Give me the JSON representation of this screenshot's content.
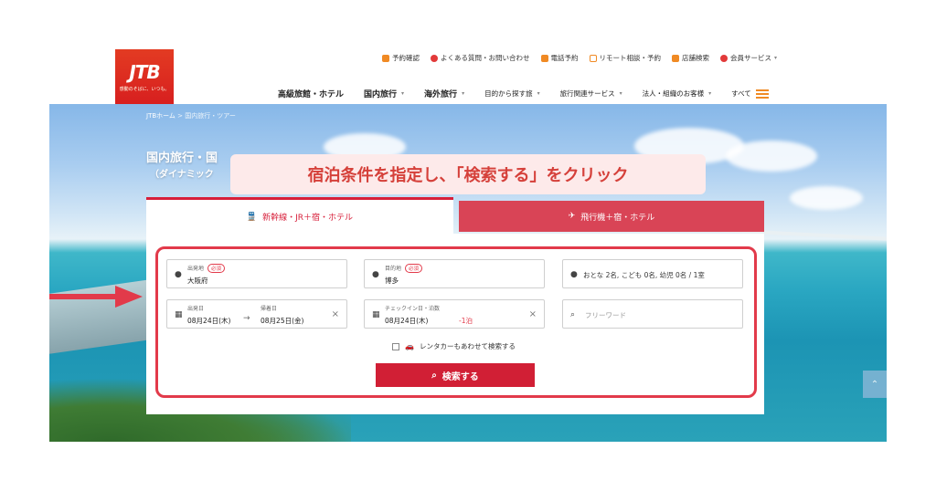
{
  "header": {
    "logo_text": "JTB",
    "logo_tagline": "感動のそばに、いつも。",
    "utility_links": [
      {
        "label": "予約確認",
        "icon": "calendar-icon"
      },
      {
        "label": "よくある質問・お問い合わせ",
        "icon": "help-icon"
      },
      {
        "label": "電話予約",
        "icon": "phone-icon"
      },
      {
        "label": "リモート相談・予約",
        "icon": "monitor-icon"
      },
      {
        "label": "店舗検索",
        "icon": "store-icon"
      },
      {
        "label": "会員サービス",
        "icon": "user-icon"
      }
    ],
    "nav": [
      {
        "label": "高級旅館・ホテル"
      },
      {
        "label": "国内旅行"
      },
      {
        "label": "海外旅行"
      },
      {
        "label": "目的から探す旅"
      },
      {
        "label": "旅行関連サービス"
      },
      {
        "label": "法人・組織のお客様"
      },
      {
        "label": "すべて"
      }
    ]
  },
  "breadcrumb": {
    "home": "JTBホーム",
    "sep": ">",
    "current": "国内旅行・ツアー"
  },
  "hero": {
    "title": "国内旅行・国",
    "subtitle": "（ダイナミック",
    "banner": "宿泊条件を指定し、「検索する」をクリック"
  },
  "tabs": [
    {
      "label": "新幹線・JR＋宿・ホテル",
      "active": true
    },
    {
      "label": "飛行機＋宿・ホテル",
      "active": false
    }
  ],
  "form": {
    "required_badge": "必須",
    "departure": {
      "label": "出発地",
      "value": "大阪府"
    },
    "destination": {
      "label": "目的地",
      "value": "博多"
    },
    "guests": {
      "value": "おとな 2名, こども 0名, 幼児 0名 / 1室"
    },
    "dates": {
      "depart_label": "出発日",
      "depart_value": "08月24日(木)",
      "return_label": "帰着日",
      "return_value": "08月25日(金)"
    },
    "checkin": {
      "label": "チェックイン日・泊数",
      "value": "08月24日(木)",
      "nights": "-1泊"
    },
    "freeword": {
      "placeholder": "フリーワード"
    },
    "rental_car": {
      "label": "レンタカーもあわせて検索する",
      "checked": false
    },
    "search_button": "検索する"
  },
  "colors": {
    "brand_red": "#d11f35",
    "annotation_red": "#e23a4a",
    "banner_bg": "#fdeaea"
  }
}
